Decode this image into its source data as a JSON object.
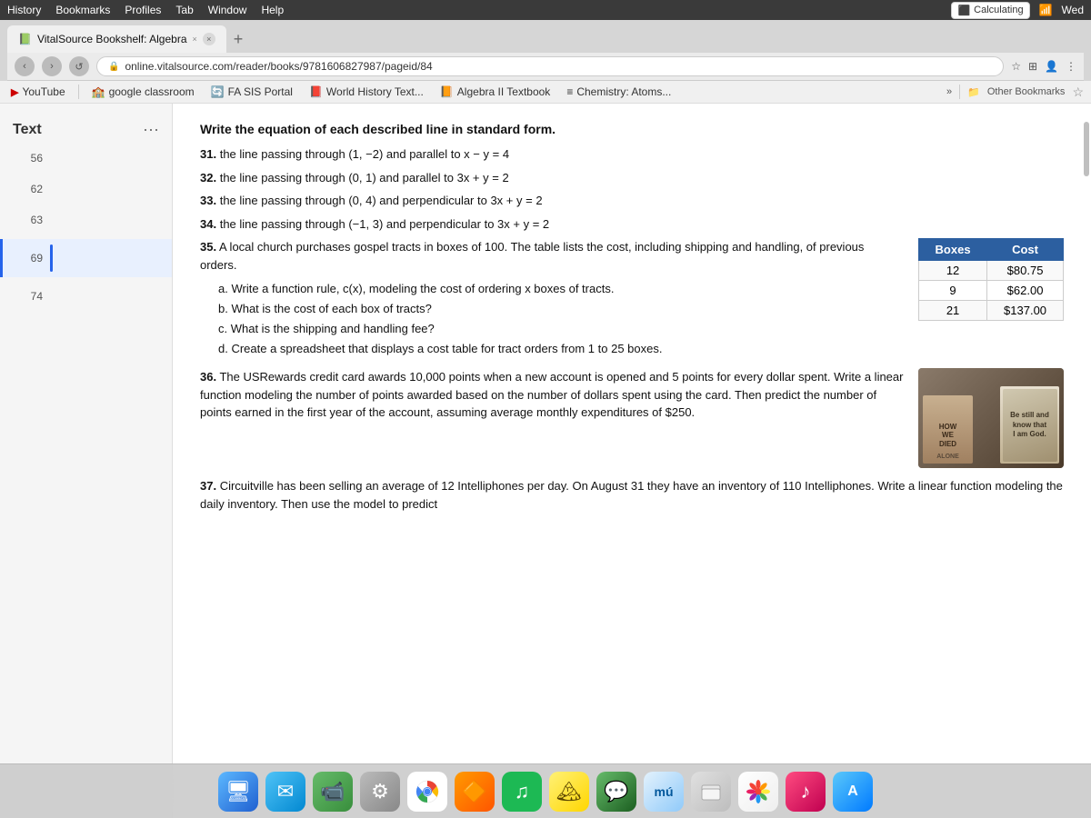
{
  "menubar": {
    "items": [
      "History",
      "Bookmarks",
      "Profiles",
      "Tab",
      "Window",
      "Help"
    ]
  },
  "browser": {
    "tab_title": "VitalSource Bookshelf: Algebra",
    "url": "online.vitalsource.com/reader/books/9781606827987/pageid/84",
    "calculating_label": "Calculating"
  },
  "bookmarks": {
    "items": [
      {
        "label": "YouTube",
        "type": "youtube"
      },
      {
        "label": "google classroom",
        "type": "google"
      },
      {
        "label": "FA SIS Portal",
        "type": "fa"
      },
      {
        "label": "World History Text...",
        "type": "world"
      },
      {
        "label": "Algebra II Textbook",
        "type": "algebra"
      },
      {
        "label": "Chemistry: Atoms...",
        "type": "chemistry"
      }
    ],
    "other_label": "Other Bookmarks"
  },
  "sidebar": {
    "title": "Text",
    "pages": [
      {
        "num": "56"
      },
      {
        "num": "62"
      },
      {
        "num": "63"
      },
      {
        "num": "69"
      },
      {
        "num": "74"
      }
    ]
  },
  "content": {
    "section_title": "Write the equation of each described line in standard form.",
    "problems": [
      {
        "num": "31.",
        "text": "the line passing through (1, −2) and parallel to x − y = 4"
      },
      {
        "num": "32.",
        "text": "the line passing through (0, 1) and parallel to 3x + y = 2"
      },
      {
        "num": "33.",
        "text": "the line passing through (0, 4) and perpendicular to 3x + y = 2"
      },
      {
        "num": "34.",
        "text": "the line passing through (−1, 3) and perpendicular to 3x + y = 2"
      }
    ],
    "problem35": {
      "num": "35.",
      "intro": "A local church purchases gospel tracts in boxes of 100. The table lists the cost, including shipping and handling, of previous orders.",
      "sub_a": "a. Write a function rule, c(x), modeling the cost of ordering x boxes of tracts.",
      "sub_b": "b. What is the cost of each box of tracts?",
      "sub_c": "c. What is the shipping and handling fee?",
      "sub_d": "d. Create a spreadsheet that displays a cost table for tract orders from 1 to 25 boxes.",
      "table": {
        "headers": [
          "Boxes",
          "Cost"
        ],
        "rows": [
          [
            "12",
            "$80.75"
          ],
          [
            "9",
            "$62.00"
          ],
          [
            "21",
            "$137.00"
          ]
        ]
      }
    },
    "problem36": {
      "num": "36.",
      "text": "The USRewards credit card awards 10,000 points when a new account is opened and 5 points for every dollar spent. Write a linear function modeling the number of points awarded based on the number of dollars spent using the card. Then predict the number of points earned in the first year of the account, assuming average monthly expenditures of $250."
    },
    "problem37": {
      "num": "37.",
      "text": "Circuitville has been selling an average of 12 Intelliphones per day. On August 31 they have an inventory of 110 Intelliphones. Write a linear function modeling the daily inventory. Then use the model to predict"
    }
  },
  "dock": {
    "items": [
      {
        "name": "finder",
        "icon": "🖥"
      },
      {
        "name": "mail",
        "icon": "✉"
      },
      {
        "name": "facetime",
        "icon": "📹"
      },
      {
        "name": "settings",
        "icon": "⚙"
      },
      {
        "name": "chrome",
        "icon": "◎"
      },
      {
        "name": "blender",
        "icon": "🔶"
      },
      {
        "name": "spotify",
        "icon": "♫"
      },
      {
        "name": "notes",
        "icon": "📋"
      },
      {
        "name": "messages",
        "icon": "💬"
      },
      {
        "name": "musescore",
        "icon": "🎵"
      },
      {
        "name": "files",
        "icon": "📁"
      },
      {
        "name": "photos",
        "icon": "🌸"
      },
      {
        "name": "music",
        "icon": "♪"
      },
      {
        "name": "app-store",
        "icon": "A"
      }
    ]
  }
}
